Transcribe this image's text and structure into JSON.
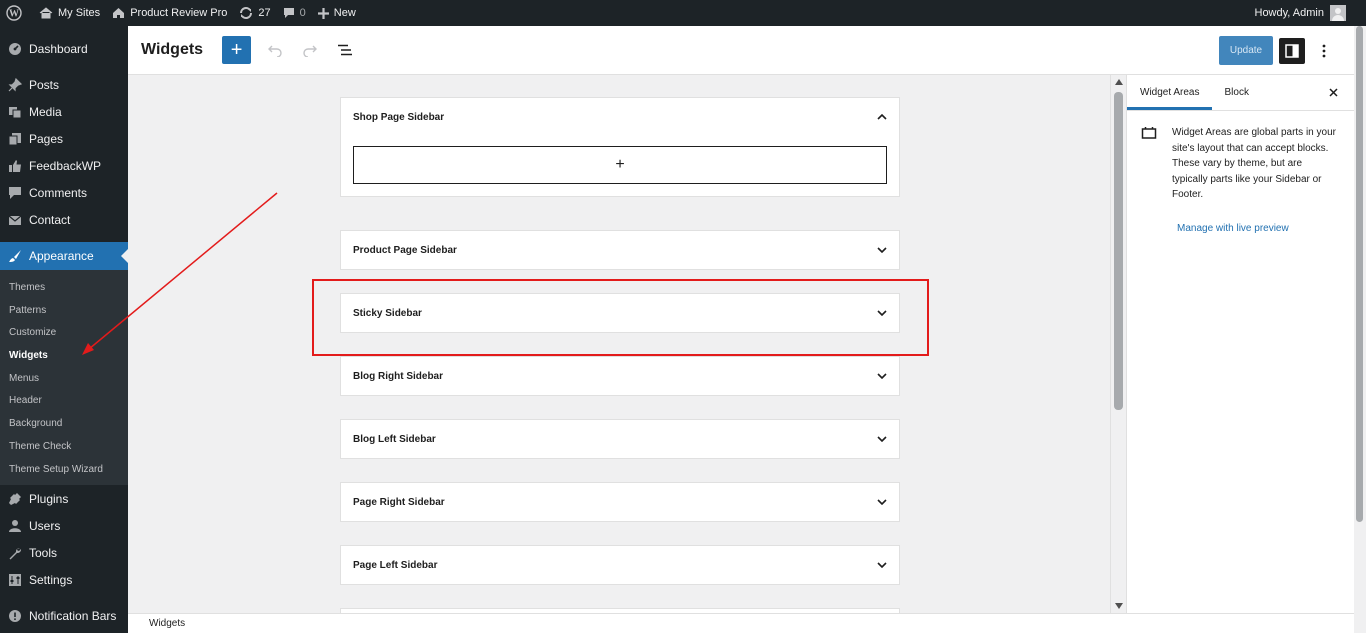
{
  "adminbar": {
    "my_sites": "My Sites",
    "site_name": "Product Review Pro",
    "updates_count": "27",
    "comments_count": "0",
    "new_label": "New",
    "howdy": "Howdy, Admin"
  },
  "sidebar": {
    "top_items": [
      {
        "label": "Dashboard",
        "icon": "dashboard-icon"
      }
    ],
    "items": [
      {
        "label": "Posts",
        "icon": "pin-icon"
      },
      {
        "label": "Media",
        "icon": "media-icon"
      },
      {
        "label": "Pages",
        "icon": "pages-icon"
      },
      {
        "label": "FeedbackWP",
        "icon": "thumbs-up-icon"
      },
      {
        "label": "Comments",
        "icon": "comment-icon"
      },
      {
        "label": "Contact",
        "icon": "mail-icon"
      }
    ],
    "appearance": {
      "label": "Appearance",
      "icon": "paintbrush-icon"
    },
    "submenu": [
      "Themes",
      "Patterns",
      "Customize",
      "Widgets",
      "Menus",
      "Header",
      "Background",
      "Theme Check",
      "Theme Setup Wizard"
    ],
    "bottom_items": [
      {
        "label": "Plugins",
        "icon": "plugin-icon"
      },
      {
        "label": "Users",
        "icon": "user-icon"
      },
      {
        "label": "Tools",
        "icon": "wrench-icon"
      },
      {
        "label": "Settings",
        "icon": "settings-icon"
      },
      {
        "label": "Notification Bars",
        "icon": "notification-icon"
      }
    ]
  },
  "header": {
    "title": "Widgets",
    "add_label": "+",
    "update_label": "Update"
  },
  "widget_areas": [
    {
      "name": "Shop Page Sidebar",
      "expanded": true
    },
    {
      "name": "Product Page Sidebar",
      "expanded": false
    },
    {
      "name": "Sticky Sidebar",
      "expanded": false
    },
    {
      "name": "Blog Right Sidebar",
      "expanded": false
    },
    {
      "name": "Blog Left Sidebar",
      "expanded": false
    },
    {
      "name": "Page Right Sidebar",
      "expanded": false
    },
    {
      "name": "Page Left Sidebar",
      "expanded": false
    }
  ],
  "appender_label": "+",
  "panel": {
    "tab_widget_areas": "Widget Areas",
    "tab_block": "Block",
    "description": "Widget Areas are global parts in your site's layout that can accept blocks. These vary by theme, but are typically parts like your Sidebar or Footer.",
    "link": "Manage with live preview"
  },
  "footer": {
    "breadcrumb": "Widgets"
  },
  "colors": {
    "accent": "#2271b1",
    "admin_dark": "#1d2327",
    "annotation_red": "#e31b1b"
  }
}
